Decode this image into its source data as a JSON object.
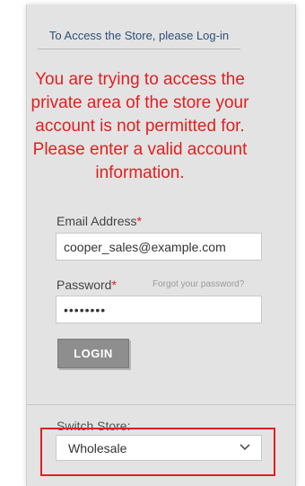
{
  "header": {
    "title": "To Access the Store, please Log-in"
  },
  "error": {
    "message": "You are trying to access the private area of the store your account is not permitted for. Please enter a valid account information."
  },
  "form": {
    "email_label": "Email Address",
    "email_required_mark": "*",
    "email_value": "cooper_sales@example.com",
    "password_label": "Password",
    "password_required_mark": "*",
    "password_value": "••••••••",
    "forgot_password_link": "Forgot your password?",
    "login_label": "LOGIN"
  },
  "store_switcher": {
    "label": "Switch Store:",
    "selected_value": "Wholesale",
    "icon": "chevron-down-icon"
  },
  "colors": {
    "error": "#e02020",
    "title": "#2e4f7a",
    "panel_background": "#e3e3e3",
    "button_background": "#8e8e8e"
  }
}
